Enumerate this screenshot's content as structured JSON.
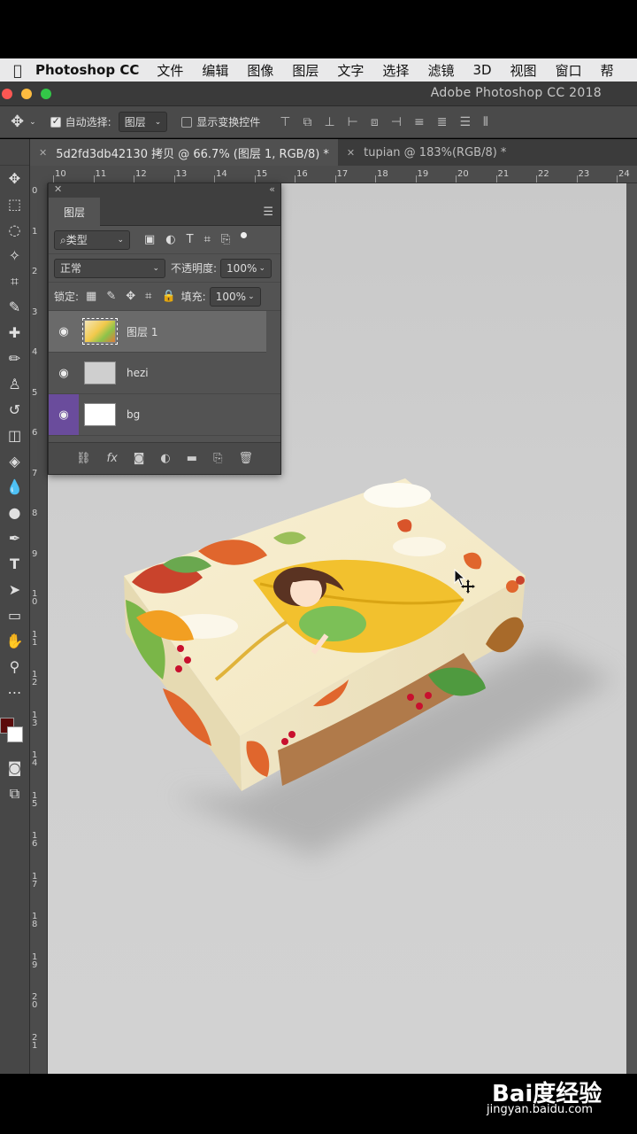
{
  "menubar": {
    "app_name": "Photoshop CC",
    "items": [
      "文件",
      "编辑",
      "图像",
      "图层",
      "文字",
      "选择",
      "滤镜",
      "3D",
      "视图",
      "窗口",
      "帮"
    ]
  },
  "titlebar": {
    "title": "Adobe Photoshop CC 2018"
  },
  "options": {
    "auto_select_label": "自动选择:",
    "auto_select_value": "图层",
    "show_transform_label": "显示变换控件"
  },
  "doc_tabs": [
    {
      "label": "5d2fd3db42130 拷贝 @ 66.7% (图层 1, RGB/8) *",
      "active": true
    },
    {
      "label": "tupian @ 183%(RGB/8) *",
      "active": false
    }
  ],
  "ruler_top": [
    "10",
    "11",
    "12",
    "13",
    "14",
    "15",
    "16",
    "17",
    "18",
    "19",
    "20",
    "21",
    "22",
    "23",
    "24"
  ],
  "ruler_left": [
    "0",
    "1",
    "2",
    "3",
    "4",
    "5",
    "6",
    "7",
    "8",
    "9",
    "1 0",
    "1 1",
    "1 2",
    "1 3",
    "1 4",
    "1 5",
    "1 6",
    "1 7",
    "1 8",
    "1 9",
    "2 0",
    "2 1"
  ],
  "layers_panel": {
    "tab_label": "图层",
    "filter_kind": "类型",
    "blend_mode": "正常",
    "opacity_label": "不透明度:",
    "opacity_value": "100%",
    "lock_label": "锁定:",
    "fill_label": "填充:",
    "fill_value": "100%",
    "layers": [
      {
        "name": "图层 1",
        "selected": true
      },
      {
        "name": "hezi",
        "selected": false
      },
      {
        "name": "bg",
        "selected": false
      }
    ]
  },
  "watermark": {
    "logo": "Bai度经验",
    "url": "jingyan.baidu.com"
  },
  "colors": {
    "foreground": "#5b0b0b",
    "background": "#ffffff",
    "panel": "#535353",
    "canvas": "#cdcdcd"
  }
}
